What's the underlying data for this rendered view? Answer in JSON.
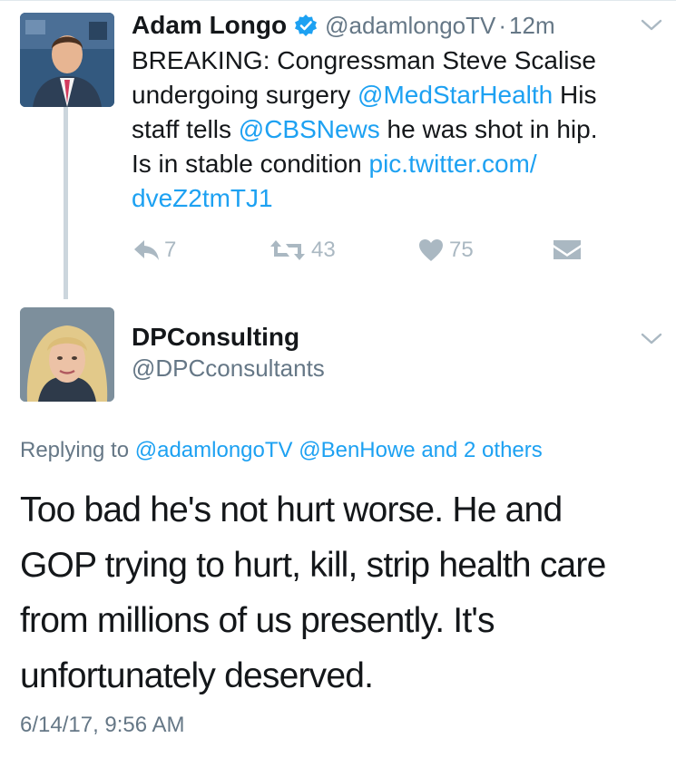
{
  "tweet1": {
    "author_name": "Adam Longo",
    "handle": "@adamlongoTV",
    "separator": "·",
    "time": "12m",
    "lines": [
      [
        {
          "t": "BREAKING: Congressman Steve Scalise"
        }
      ],
      [
        {
          "t": "undergoing surgery "
        },
        {
          "t": "@MedStarHealth",
          "link": true
        },
        {
          "t": " His"
        }
      ],
      [
        {
          "t": "staff tells "
        },
        {
          "t": "@CBSNews",
          "link": true
        },
        {
          "t": " he was shot in hip."
        }
      ],
      [
        {
          "t": "Is in stable condition "
        },
        {
          "t": "pic.twitter.com/",
          "link": true
        }
      ],
      [
        {
          "t": "dveZ2tmTJ1",
          "link": true
        }
      ]
    ],
    "actions": {
      "reply_count": "7",
      "retweet_count": "43",
      "like_count": "75"
    }
  },
  "tweet2": {
    "author_name": "DPConsulting",
    "handle": "@DPCconsultants",
    "replying": {
      "prefix": "Replying to ",
      "mention1": "@adamlongoTV",
      "mention2": "@BenHowe",
      "others": "and 2 others"
    },
    "lines": [
      "Too bad he's not hurt worse. He and",
      "GOP trying to hurt, kill, strip health care",
      "from millions of us presently. It's",
      "unfortunately deserved."
    ],
    "timestamp": "6/14/17, 9:56 AM"
  },
  "icons": {
    "verified": "verified-badge-icon",
    "caret": "chevron-down-icon",
    "reply": "reply-icon",
    "retweet": "retweet-icon",
    "like": "heart-icon",
    "dm": "direct-message-icon"
  },
  "colors": {
    "link": "#1da1f2",
    "secondary": "#657786",
    "action": "#aab8c2",
    "text": "#14171a",
    "thread_line": "#ccd6dd"
  }
}
